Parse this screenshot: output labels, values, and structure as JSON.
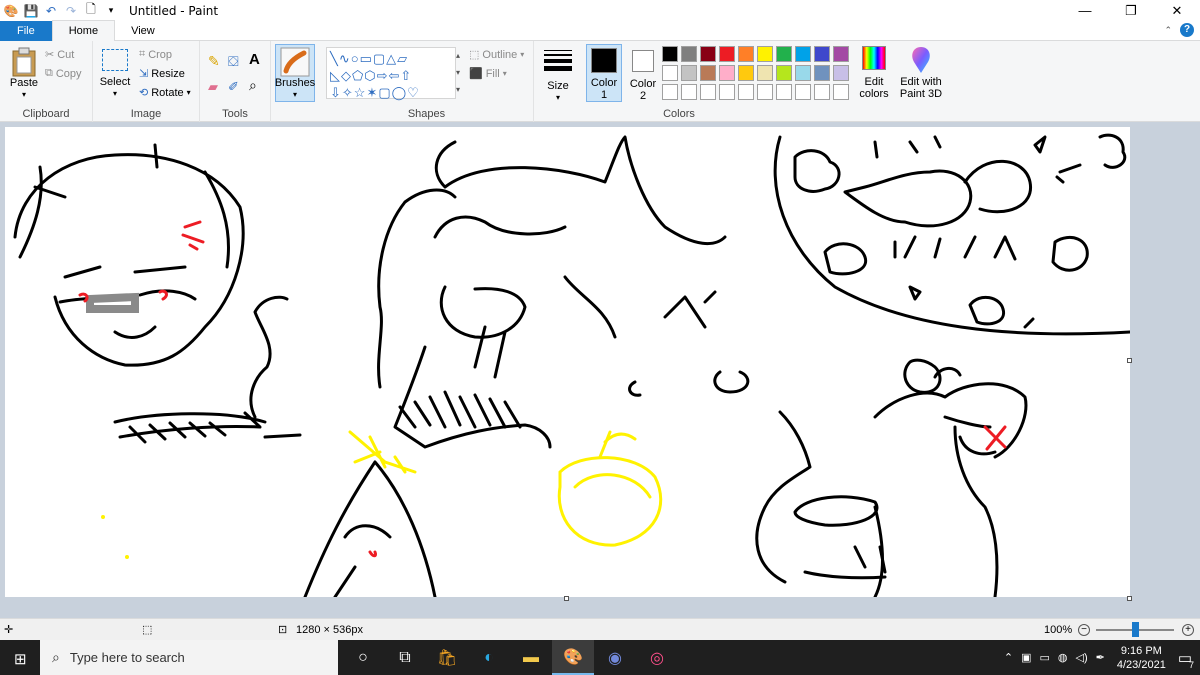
{
  "window": {
    "title": "Untitled - Paint",
    "minimize": "—",
    "maximize": "❐",
    "close": "✕"
  },
  "tabs": [
    {
      "label": "File"
    },
    {
      "label": "Home"
    },
    {
      "label": "View"
    }
  ],
  "clipboard": {
    "paste": "Paste",
    "cut": "Cut",
    "copy": "Copy",
    "label": "Clipboard"
  },
  "image": {
    "select": "Select",
    "crop": "Crop",
    "resize": "Resize",
    "rotate": "Rotate",
    "label": "Image"
  },
  "tools": {
    "label": "Tools",
    "text_glyph": "A"
  },
  "brushes": {
    "label": "Brushes"
  },
  "shapes": {
    "outline": "Outline",
    "fill": "Fill",
    "label": "Shapes"
  },
  "size": {
    "label": "Size"
  },
  "colors": {
    "color1": "Color 1",
    "color2": "Color 2",
    "label": "Colors",
    "edit_colors": "Edit colors",
    "edit_paint3d": "Edit with Paint 3D",
    "color1_value": "#000000",
    "color2_value": "#ffffff",
    "palette_row1": [
      "#000000",
      "#7f7f7f",
      "#880015",
      "#ed1c24",
      "#ff7f27",
      "#fff200",
      "#22b14c",
      "#00a2e8",
      "#3f48cc",
      "#a349a4"
    ],
    "palette_row2": [
      "#ffffff",
      "#c3c3c3",
      "#b97a57",
      "#ffaec9",
      "#ffc90e",
      "#efe4b0",
      "#b5e61d",
      "#99d9ea",
      "#7092be",
      "#c8bfe7"
    ],
    "palette_row3": [
      "#ffffff",
      "#ffffff",
      "#ffffff",
      "#ffffff",
      "#ffffff",
      "#ffffff",
      "#ffffff",
      "#ffffff",
      "#ffffff",
      "#ffffff"
    ]
  },
  "status": {
    "dimensions": "1280 × 536px",
    "zoom": "100%"
  },
  "taskbar": {
    "search_placeholder": "Type here to search",
    "time": "9:16 PM",
    "date": "4/23/2021",
    "notifications": "7"
  }
}
